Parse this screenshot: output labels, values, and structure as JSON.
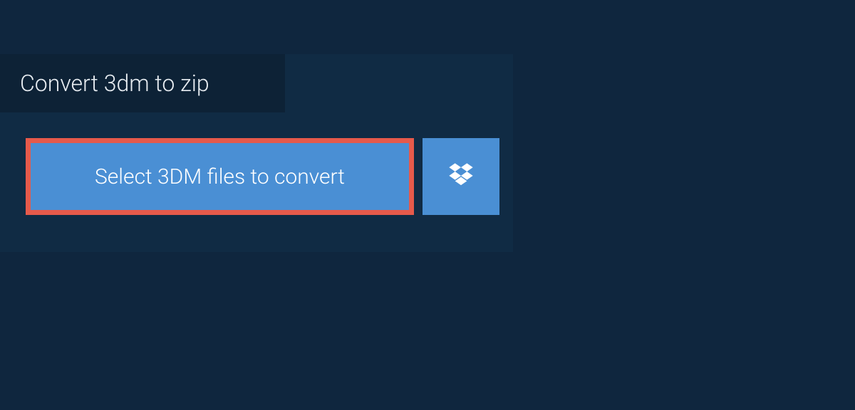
{
  "heading": {
    "title": "Convert 3dm to zip"
  },
  "actions": {
    "select_label": "Select 3DM files to convert"
  },
  "colors": {
    "page_bg": "#0f263e",
    "card_bg": "#102b44",
    "tab_bg": "#0d2236",
    "button_bg": "#4a8fd4",
    "highlight_border": "#e65a4b",
    "text_light": "#e8edf2",
    "text_white": "#ffffff"
  }
}
